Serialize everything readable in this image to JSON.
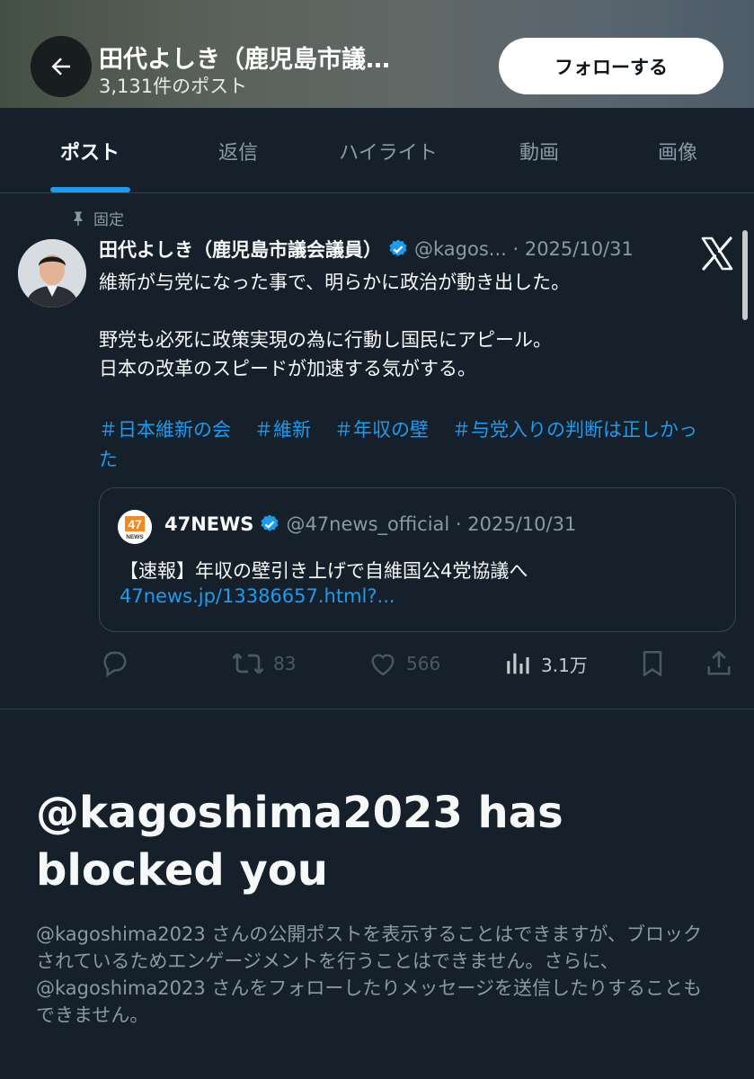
{
  "header": {
    "name": "田代よしき（鹿児島市議…",
    "post_count": "3,131件のポスト",
    "follow_label": "フォローする"
  },
  "tabs": [
    "ポスト",
    "返信",
    "ハイライト",
    "動画",
    "画像"
  ],
  "pinned_label": "固定",
  "tweet": {
    "author_name": "田代よしき（鹿児島市議会議員）",
    "handle_date": "@kagos... · 2025/10/31",
    "lines": [
      "維新が与党になった事で、明らかに政治が動き出した。",
      "",
      "野党も必死に政策実現の為に行動し国民にアピール。",
      "日本の改革のスピードが加速する気がする。"
    ],
    "hashtags": [
      "＃日本維新の会",
      "＃維新",
      "＃年収の壁",
      "＃与党入りの判断は正しかった"
    ],
    "quote": {
      "logo_text": "47",
      "logo_sub": "NEWS",
      "name": "47NEWS",
      "handle_date": "@47news_official · 2025/10/31",
      "text": "【速報】年収の壁引き上げで自維国公4党協議へ",
      "link": "47news.jp/13386657.html?..."
    },
    "stats": {
      "retweets": "83",
      "likes": "566",
      "views": "3.1万"
    }
  },
  "blocked": {
    "title": "@kagoshima2023 has blocked you",
    "description": "@kagoshima2023 さんの公開ポストを表示することはできますが、ブロックされているためエンゲージメントを行うことはできません。さらに、@kagoshima2023 さんをフォローしたりメッセージを送信したりすることもできません。"
  },
  "colors": {
    "background": "#15202b",
    "accent": "#1d9bf0",
    "muted_text": "#8b98a5"
  }
}
